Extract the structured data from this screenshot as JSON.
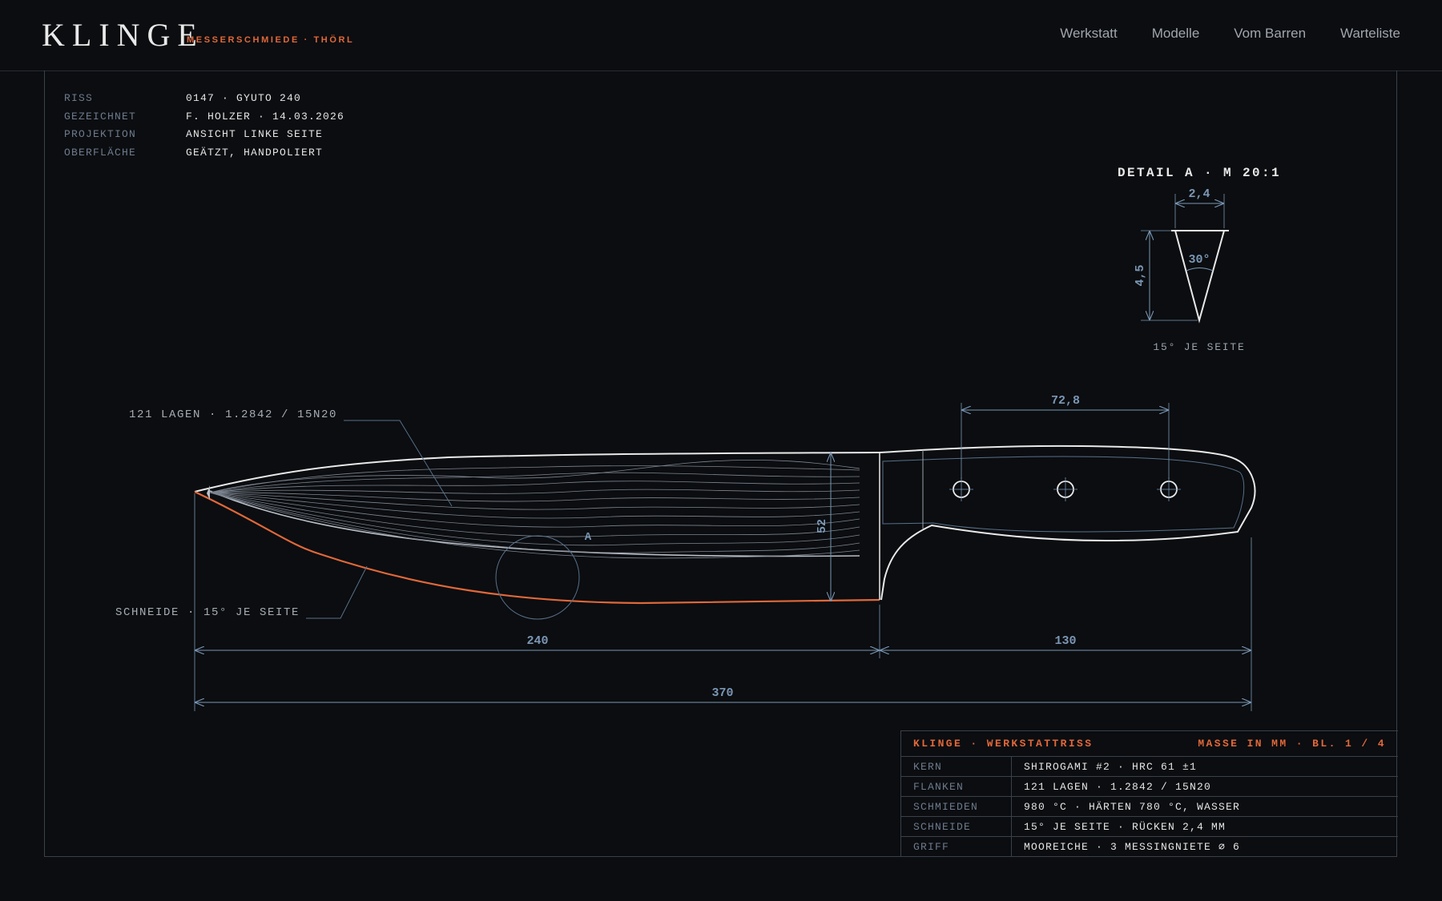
{
  "header": {
    "logo": "KLINGE",
    "tagline": "MESSERSCHMIEDE · THÖRL",
    "nav": [
      "Werkstatt",
      "Modelle",
      "Vom Barren",
      "Warteliste"
    ]
  },
  "meta": [
    {
      "label": "RISS",
      "value": "0147 · GYUTO 240"
    },
    {
      "label": "GEZEICHNET",
      "value": "F. HOLZER · 14.03.2026"
    },
    {
      "label": "PROJEKTION",
      "value": "ANSICHT LINKE SEITE"
    },
    {
      "label": "OBERFLÄCHE",
      "value": "GEÄTZT, HANDPOLIERT"
    }
  ],
  "drawing": {
    "detail_title": "DETAIL A · M 20:1",
    "detail_width": "2,4",
    "detail_height": "4,5",
    "detail_angle": "30°",
    "detail_caption": "15° JE SEITE",
    "callout_layers": "121 LAGEN · 1.2842 / 15N20",
    "callout_edge": "SCHNEIDE · 15° JE SEITE",
    "detail_marker": "A",
    "dim_blade_height": "52",
    "dim_rivet_span": "72,8",
    "dim_blade": "240",
    "dim_handle": "130",
    "dim_total": "370"
  },
  "title_block": {
    "left": "KLINGE · WERKSTATTRISS",
    "right": "MASSE IN MM · BL. 1 / 4",
    "rows": [
      {
        "label": "KERN",
        "value": "SHIROGAMI #2 · HRC 61 ±1"
      },
      {
        "label": "FLANKEN",
        "value": "121 LAGEN · 1.2842 / 15N20"
      },
      {
        "label": "SCHMIEDEN",
        "value": "980 °C · HÄRTEN 780 °C, WASSER"
      },
      {
        "label": "SCHNEIDE",
        "value": "15° JE SEITE · RÜCKEN 2,4 MM"
      },
      {
        "label": "GRIFF",
        "value": "MOOREICHE · 3 MESSINGNIETE ⌀ 6"
      }
    ]
  },
  "colors": {
    "background": "#0b0d10",
    "accent": "#e0683a",
    "dimension": "#7a96b4",
    "line": "#e9e9e9",
    "frame": "#3a414b"
  }
}
